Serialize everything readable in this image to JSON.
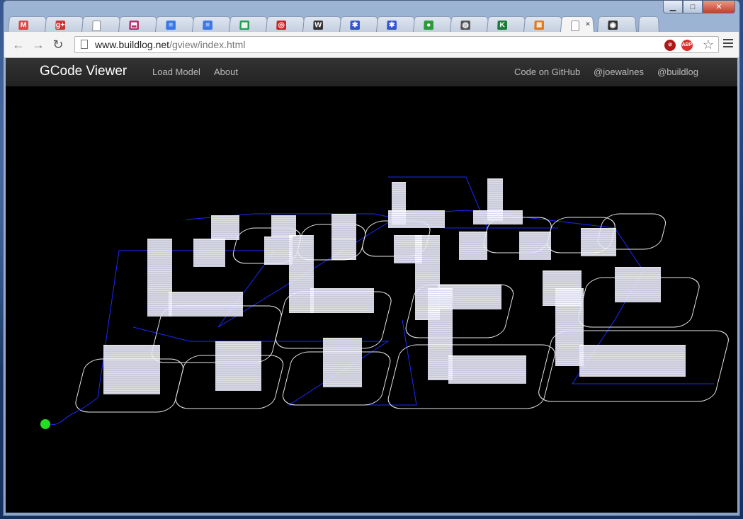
{
  "browser": {
    "tabs": [
      {
        "icon": "gmail-icon",
        "glyph": "M",
        "color": "#d44"
      },
      {
        "icon": "google-plus-icon",
        "glyph": "g+",
        "color": "#c33"
      },
      {
        "icon": "blank-page-icon",
        "glyph": "",
        "color": "#fff"
      },
      {
        "icon": "pdf-icon",
        "glyph": "⬒",
        "color": "#b0306c"
      },
      {
        "icon": "google-docs-icon",
        "glyph": "≡",
        "color": "#3b78e7"
      },
      {
        "icon": "google-docs-icon",
        "glyph": "≡",
        "color": "#3b78e7"
      },
      {
        "icon": "google-sheets-icon",
        "glyph": "▦",
        "color": "#1f9d55"
      },
      {
        "icon": "opera-icon",
        "glyph": "◎",
        "color": "#c22"
      },
      {
        "icon": "wikipedia-icon",
        "glyph": "W",
        "color": "#333"
      },
      {
        "icon": "gear-blue-icon",
        "glyph": "✱",
        "color": "#3355cc"
      },
      {
        "icon": "gear-blue-icon",
        "glyph": "✱",
        "color": "#3355cc"
      },
      {
        "icon": "evernote-icon",
        "glyph": "●",
        "color": "#2a9a3a"
      },
      {
        "icon": "spiral-icon",
        "glyph": "◍",
        "color": "#555"
      },
      {
        "icon": "k-icon",
        "glyph": "K",
        "color": "#1a7a3a"
      },
      {
        "icon": "stack-overflow-icon",
        "glyph": "≣",
        "color": "#e07a1f"
      },
      {
        "icon": "blank-page-icon",
        "glyph": "",
        "color": "#fff",
        "active": true
      },
      {
        "icon": "github-icon",
        "glyph": "◉",
        "color": "#333"
      }
    ],
    "url_host": "www.buildlog.net",
    "url_path": "/gview/index.html",
    "extensions": [
      {
        "icon": "no-script-icon",
        "label": "",
        "color": "#b01818"
      },
      {
        "icon": "adblock-icon",
        "label": "ABP",
        "color": "#d9302a"
      }
    ]
  },
  "navbar": {
    "brand": "GCode Viewer",
    "left_links": [
      "Load Model",
      "About"
    ],
    "right_links": [
      "Code on GitHub",
      "@joewalnes",
      "@buildlog"
    ]
  },
  "viewer": {
    "background": "#000000",
    "model_color": "#ffffff",
    "toolpath_color": "#1a2aff",
    "start_marker_color": "#22dd22"
  }
}
